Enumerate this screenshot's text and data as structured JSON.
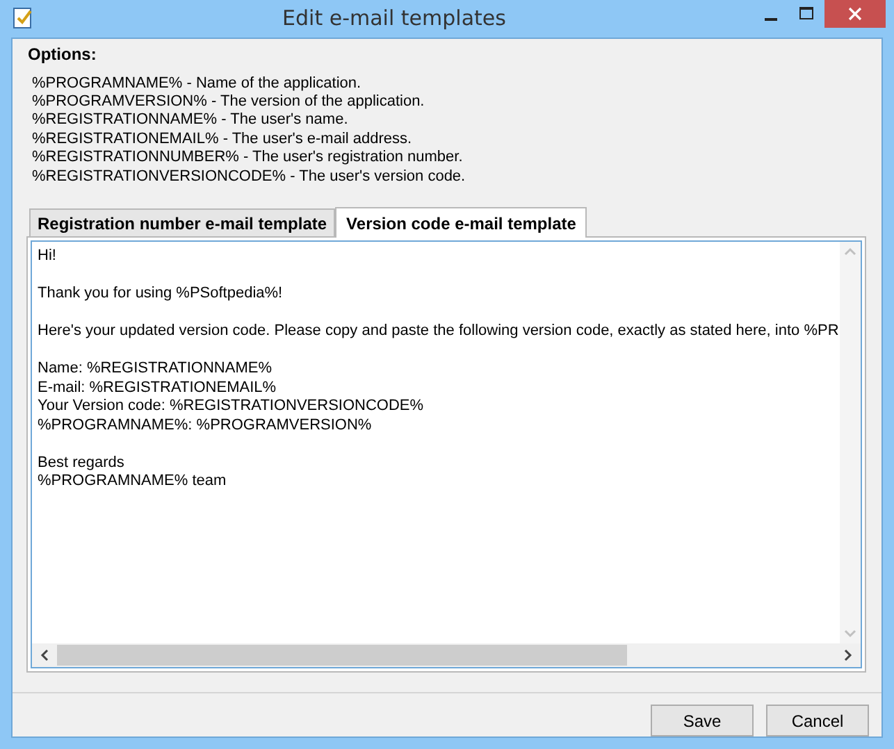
{
  "window": {
    "title": "Edit e-mail templates"
  },
  "options": {
    "label": "Options:",
    "lines": [
      "%PROGRAMNAME% - Name of the application.",
      "%PROGRAMVERSION% - The version of the application.",
      "%REGISTRATIONNAME% - The user's name.",
      "%REGISTRATIONEMAIL% - The user's e-mail address.",
      "%REGISTRATIONNUMBER% - The user's registration number.",
      "%REGISTRATIONVERSIONCODE% - The user's version code."
    ]
  },
  "tabs": [
    {
      "label": "Registration number e-mail template",
      "selected": false
    },
    {
      "label": "Version code e-mail template",
      "selected": true
    }
  ],
  "editor": {
    "paragraphs": [
      [
        "Hi!"
      ],
      [
        "Thank you for using %PSoftpedia%!"
      ],
      [
        "Here's your updated version code. Please copy and paste the following version code, exactly as stated here, into %PR"
      ],
      [
        "Name: %REGISTRATIONNAME%",
        "E-mail: %REGISTRATIONEMAIL%",
        "Your Version code: %REGISTRATIONVERSIONCODE%",
        "%PROGRAMNAME%: %PROGRAMVERSION%"
      ],
      [
        "Best regards",
        "%PROGRAMNAME% team"
      ]
    ]
  },
  "buttons": [
    "Save",
    "Cancel"
  ]
}
